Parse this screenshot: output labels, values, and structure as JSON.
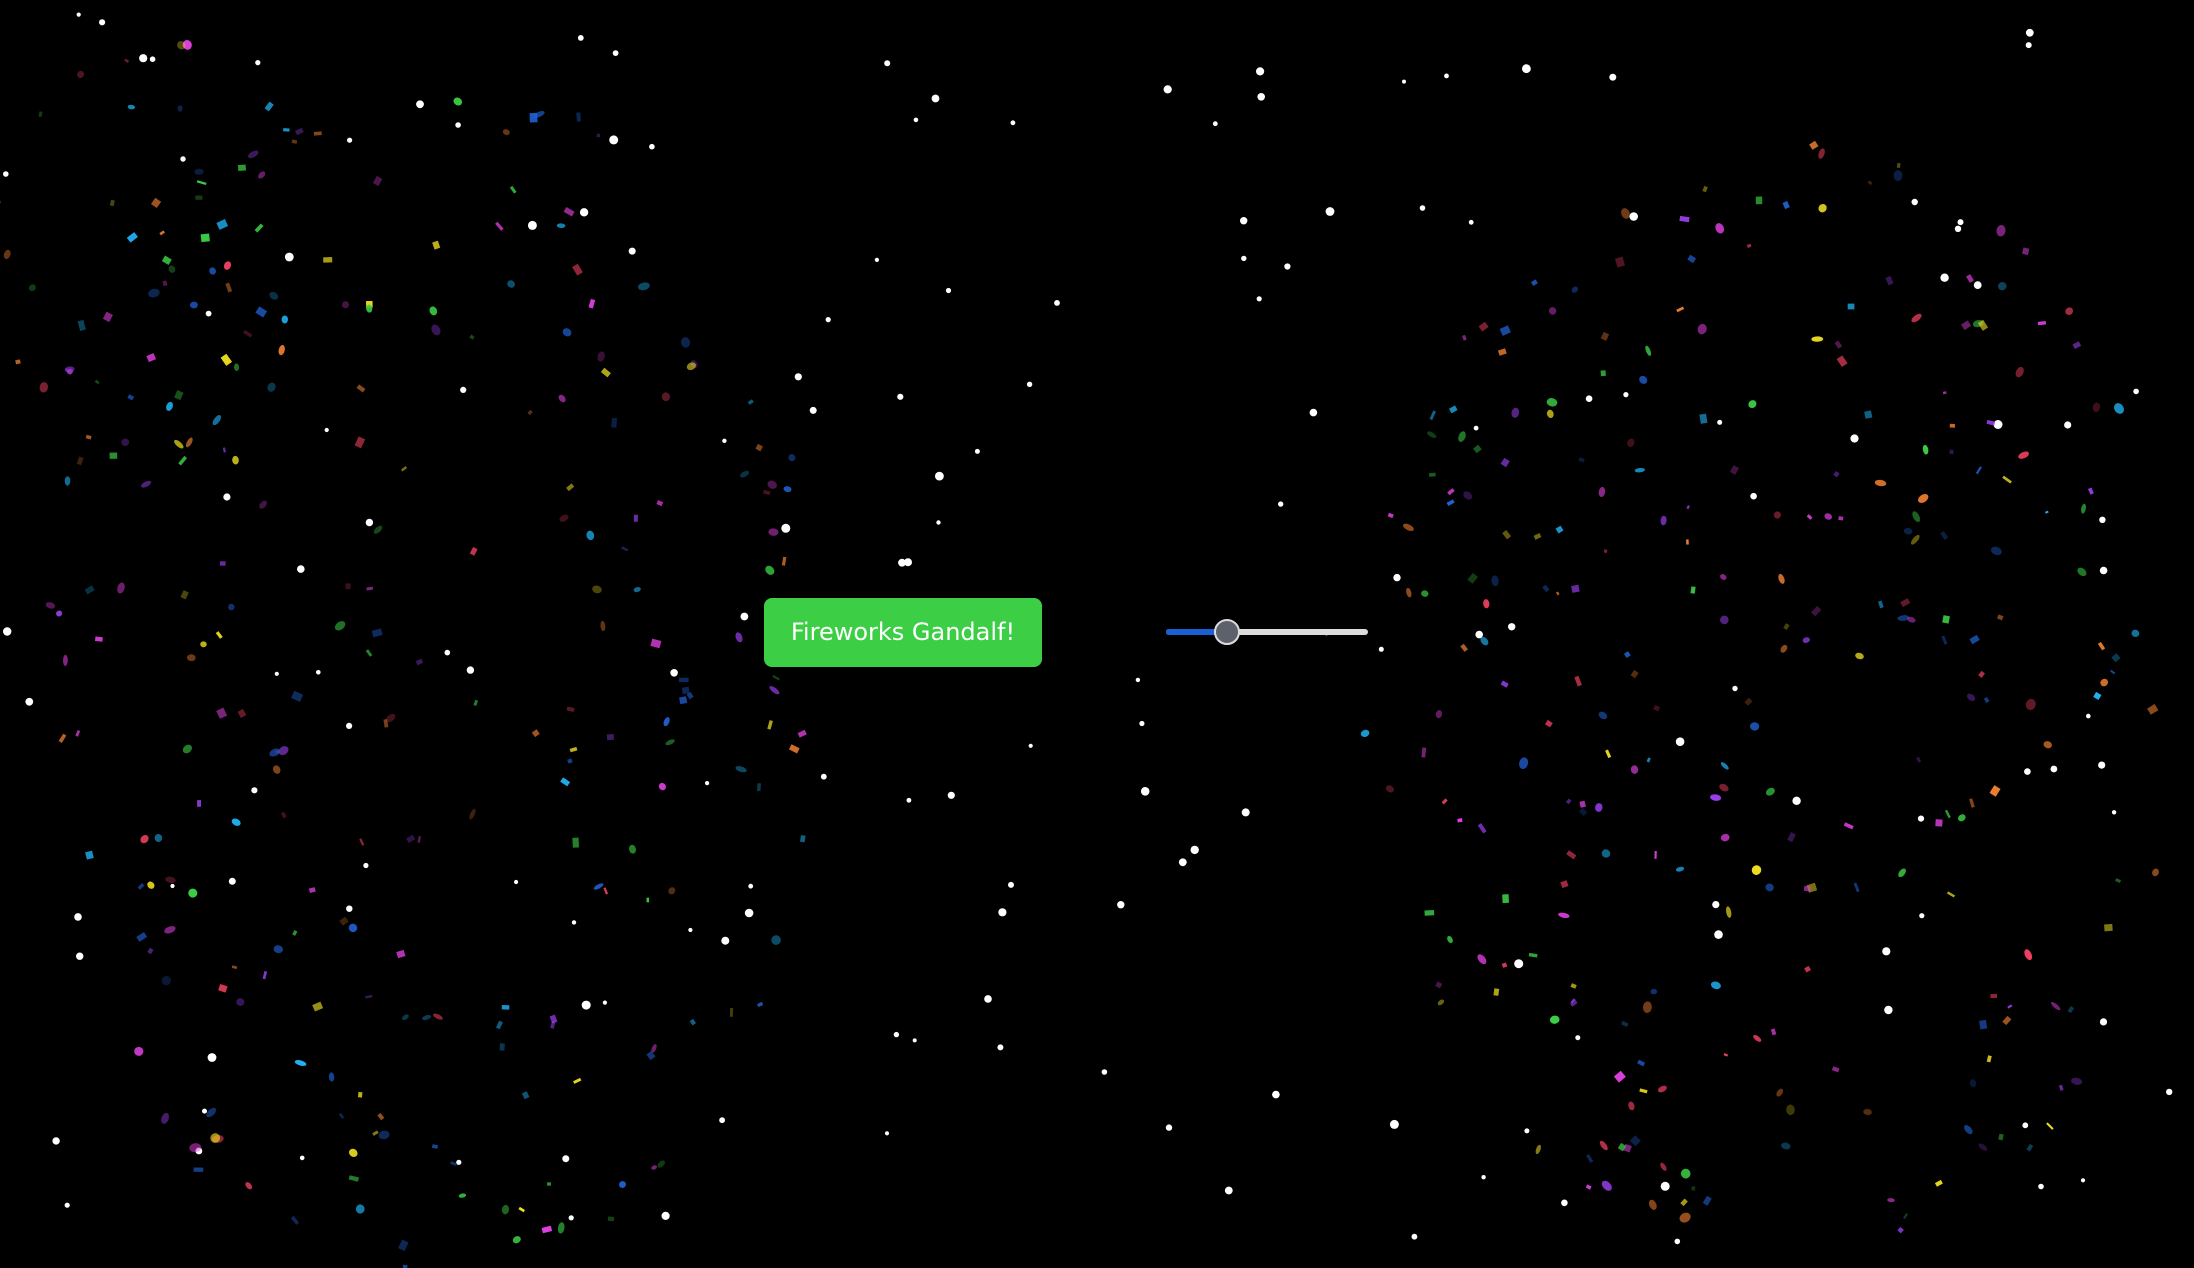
{
  "page": {
    "background_color": "#000000"
  },
  "controls": {
    "fireworks_button": {
      "label": "Fireworks Gandalf!",
      "color": "#3ccf46",
      "text_color": "#ffffff"
    },
    "slider": {
      "value_fraction": 0.3,
      "fill_color": "#1a5fd6",
      "track_color": "#dcdcdc",
      "thumb_color": "#5c616b"
    }
  },
  "effects": {
    "stars_color": "#ffffff",
    "confetti_colors": [
      "#e040e0",
      "#9b40f0",
      "#3ccf46",
      "#f04060",
      "#20b0f0",
      "#f0e020",
      "#f08030",
      "#2060d0"
    ]
  }
}
